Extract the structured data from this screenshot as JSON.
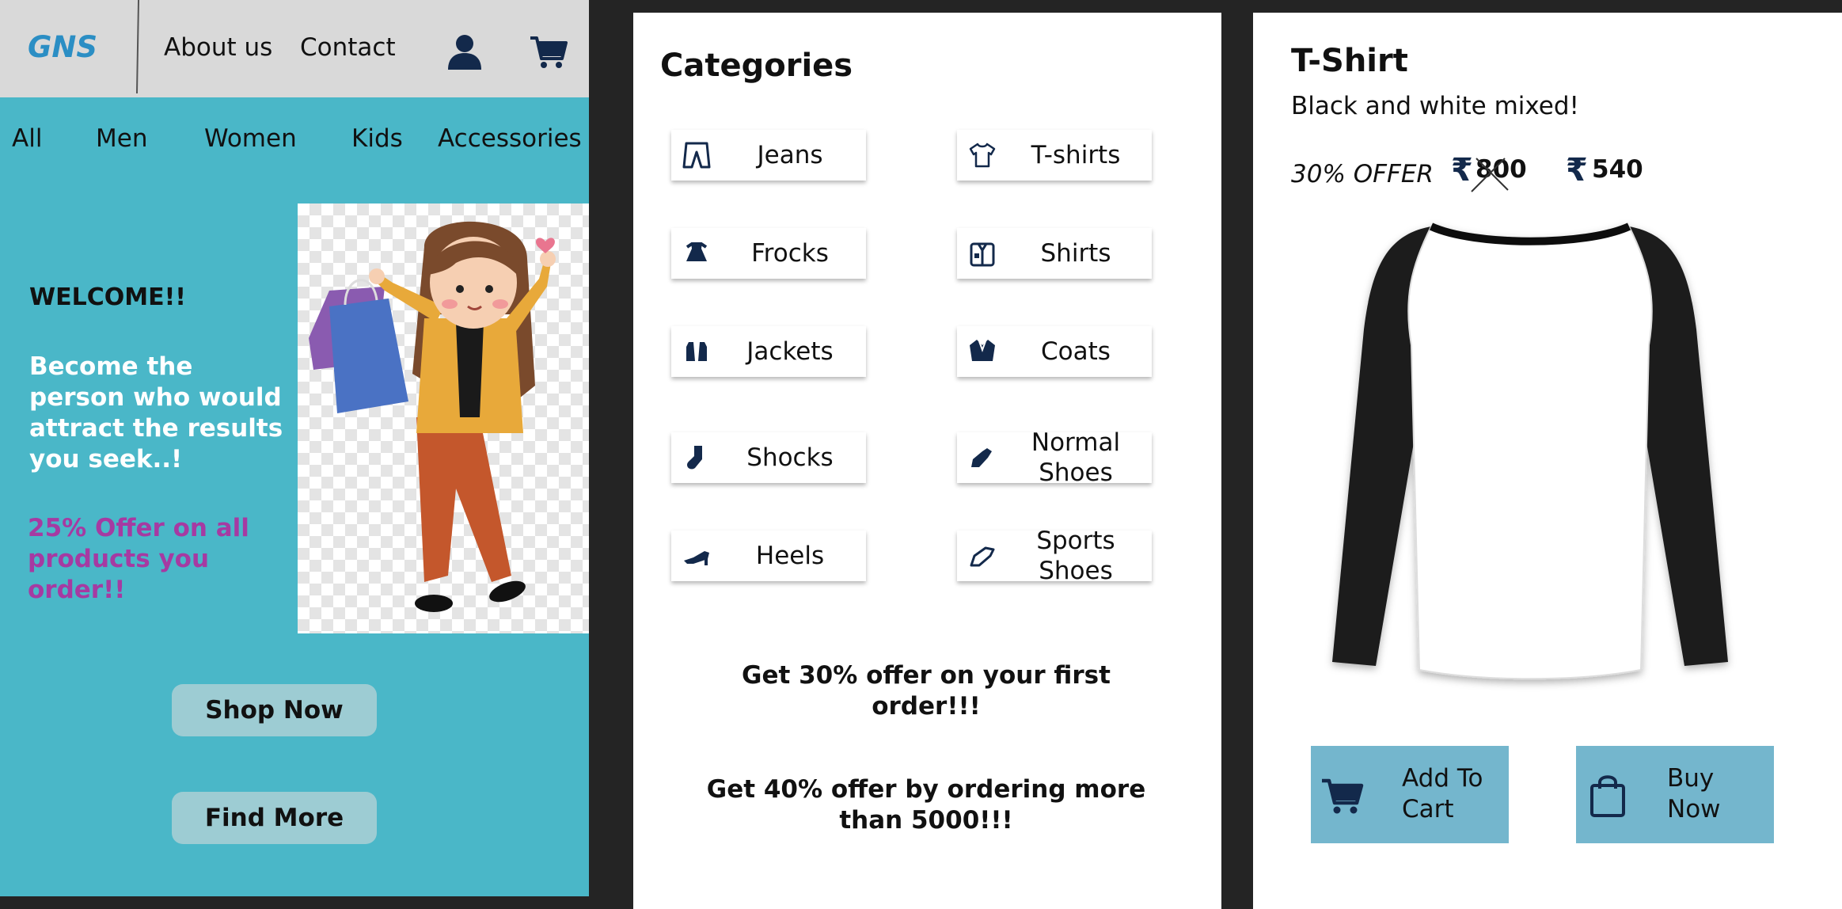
{
  "home": {
    "logo": "GNS",
    "nav": {
      "about": "About us",
      "contact": "Contact"
    },
    "icons": {
      "account": "user-icon",
      "cart": "cart-icon"
    },
    "categories": [
      "All",
      "Men",
      "Women",
      "Kids",
      "Accessories"
    ],
    "welcome": "WELCOME!!",
    "tagline": "Become the person who would attract the results you seek..!",
    "offer": "25% Offer on all products you order!!",
    "buttons": {
      "shop_now": "Shop Now",
      "find_more": "Find More"
    }
  },
  "categories_page": {
    "title": "Categories",
    "items": [
      {
        "label": "Jeans",
        "icon": "jeans-icon"
      },
      {
        "label": "T-shirts",
        "icon": "tshirt-icon"
      },
      {
        "label": "Frocks",
        "icon": "frock-icon"
      },
      {
        "label": "Shirts",
        "icon": "shirt-icon"
      },
      {
        "label": "Jackets",
        "icon": "jacket-icon"
      },
      {
        "label": "Coats",
        "icon": "coat-icon"
      },
      {
        "label": "Shocks",
        "icon": "sock-icon"
      },
      {
        "label": "Normal Shoes",
        "icon": "shoe-icon"
      },
      {
        "label": "Heels",
        "icon": "heel-icon"
      },
      {
        "label": "Sports Shoes",
        "icon": "sneaker-icon"
      }
    ],
    "promo1": "Get 30% offer on your first order!!!",
    "promo2": "Get 40% offer by ordering more than 5000!!!"
  },
  "product": {
    "title": "T-Shirt",
    "description": "Black and white mixed!",
    "offer_label": "30% OFFER",
    "currency_symbol": "₹",
    "original_price": "800",
    "sale_price": "540",
    "add_to_cart": "Add To Cart",
    "buy_now": "Buy Now"
  },
  "colors": {
    "background": "#242424",
    "home_bg": "#4ab7c8",
    "topbar": "#d9d9d9",
    "logo": "#2b8ec4",
    "offer_text": "#a63aa2",
    "pill_button": "#9dccd3",
    "action_button": "#74b6cd",
    "icon_navy": "#13294b"
  }
}
